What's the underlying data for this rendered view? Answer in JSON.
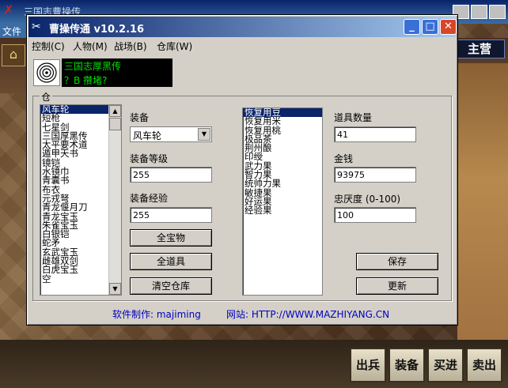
{
  "background": {
    "title": "三国志曹操传",
    "menu_file": "文件",
    "camp_label": "主营",
    "commands": [
      "出兵",
      "装备",
      "买进",
      "卖出"
    ]
  },
  "window": {
    "title": "曹操传通 v10.2.16",
    "controls": {
      "minimize": "_",
      "maximize": "□",
      "close": "✕"
    },
    "menu": [
      "控制(C)",
      "人物(M)",
      "战场(B)",
      "仓库(W)"
    ],
    "header": {
      "line1": "三国志厚黑传",
      "line2": "？B 攢堵?"
    },
    "group_label": "仓",
    "equipment_list": [
      "风车轮",
      "短枪",
      "七星剑",
      "三国厚黑传",
      "太平要术道",
      "遁甲天书",
      "镜铠",
      "水镜巾",
      "青囊书",
      "布衣",
      "元戎弩",
      "青龙偃月刀",
      "青龙宝玉",
      "朱雀宝玉",
      "白银铠",
      "蛇矛",
      "玄武宝玉",
      "雌雄双剑",
      "白虎宝玉",
      "空"
    ],
    "equipment_selected": 0,
    "equip_label": "装备",
    "equip_value": "风车轮",
    "level_label": "装备等级",
    "level_value": "255",
    "exp_label": "装备经验",
    "exp_value": "255",
    "btn_all_treasures": "全宝物",
    "btn_all_items": "全道具",
    "btn_clear_warehouse": "清空仓库",
    "item_list": [
      "恢复用豆",
      "恢复用米",
      "恢复用桃",
      "极品茶",
      "荆州酿",
      "印绶",
      "武力果",
      "智力果",
      "统帅力果",
      "敏捷果",
      "好运果",
      "经验果"
    ],
    "item_selected": 0,
    "qty_label": "道具数量",
    "qty_value": "41",
    "gold_label": "金钱",
    "gold_value": "93975",
    "loyalty_label": "忠厌度 (0-100)",
    "loyalty_value": "100",
    "btn_save": "保存",
    "btn_refresh": "更新",
    "footer_author": "软件制作: majiming",
    "footer_site": "网站: HTTP://WWW.MAZHIYANG.CN"
  }
}
